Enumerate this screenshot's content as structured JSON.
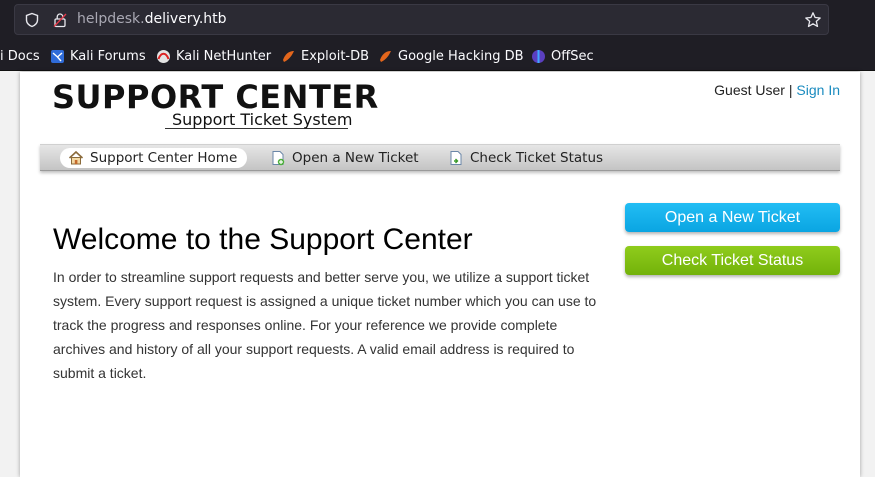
{
  "browser": {
    "url_prefix": "helpdesk.",
    "url_domain": "delivery.htb",
    "bookmarks": [
      {
        "label": "i Docs",
        "icon": "none"
      },
      {
        "label": "Kali Forums",
        "icon": "kali-forums-icon"
      },
      {
        "label": "Kali NetHunter",
        "icon": "kali-nethunter-icon"
      },
      {
        "label": "Exploit-DB",
        "icon": "exploit-db-icon"
      },
      {
        "label": "Google Hacking DB",
        "icon": "ghdb-icon"
      },
      {
        "label": "OffSec",
        "icon": "offsec-icon"
      }
    ]
  },
  "header": {
    "logo_title": "SUPPORT CENTER",
    "logo_subtitle": "Support Ticket System",
    "user_label": "Guest User",
    "separator": "|",
    "sign_in": "Sign In"
  },
  "nav": {
    "items": [
      {
        "label": "Support Center Home",
        "icon": "home-icon",
        "active": true
      },
      {
        "label": "Open a New Ticket",
        "icon": "new-ticket-icon",
        "active": false
      },
      {
        "label": "Check Ticket Status",
        "icon": "ticket-status-icon",
        "active": false
      }
    ]
  },
  "main": {
    "title": "Welcome to the Support Center",
    "body": "In order to streamline support requests and better serve you, we utilize a support ticket system. Every support request is assigned a unique ticket number which you can use to track the progress and responses online. For your reference we provide complete archives and history of all your support requests. A valid email address is required to submit a ticket."
  },
  "sidebar": {
    "open_ticket": "Open a New Ticket",
    "check_status": "Check Ticket Status"
  },
  "colors": {
    "link": "#1a8bbf",
    "blue_button": "#0aa5e2",
    "green_button": "#73b20a"
  }
}
